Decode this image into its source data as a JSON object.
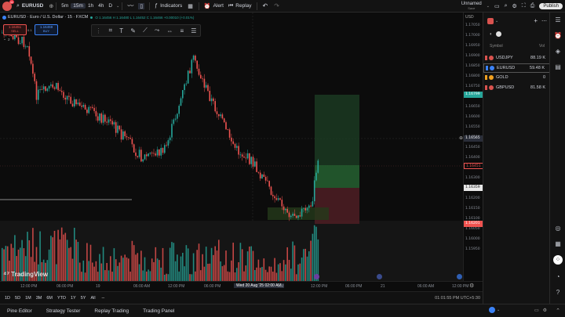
{
  "topbar": {
    "avatar_badge": "11",
    "symbol": "EURUSD",
    "intervals": [
      "5m",
      "15m",
      "1h",
      "4h",
      "D"
    ],
    "active_interval": "15m",
    "indicators_label": "Indicators",
    "alert_label": "Alert",
    "replay_label": "Replay",
    "layout_name": "Unnamed",
    "layout_status": "Save",
    "publish_label": "Publish"
  },
  "legend": {
    "title": "EURUSD · Euro / U.S. Dollar · 15 · FXCM",
    "ohlc": "O 1.16456  H 1.16480  L 1.16452  C 1.16466  +0.00010 (+0.01%)",
    "sell_price": "1.16451",
    "sell_label": "SELL",
    "spread": "0.1",
    "buy_price": "1.16459",
    "buy_label": "BUY",
    "volume_count": "2"
  },
  "price_axis": {
    "currency": "USD",
    "labels": [
      "1.17050",
      "1.17000",
      "1.16950",
      "1.16900",
      "1.16850",
      "1.16800",
      "1.16750",
      "1.16700",
      "1.16650",
      "1.16600",
      "1.16550",
      "1.16500",
      "1.16450",
      "1.16400",
      "1.16350",
      "1.16300",
      "1.16250",
      "1.16200",
      "1.16150",
      "1.16100",
      "1.16050",
      "1.16000",
      "1.15950"
    ],
    "target_price": "1.16799",
    "crosshair_price": "1.16565",
    "current_price": "1.16451",
    "entry_price": "1.16359",
    "stop_price": "1.16201"
  },
  "time_axis": {
    "labels": [
      "12:00 PM",
      "06:00 PM",
      "19",
      "06:00 AM",
      "12:00 PM",
      "06:00 PM",
      "Wed 20 Aug '25  02:00 AM",
      "AM",
      "12:00 PM",
      "06:00 PM",
      "21",
      "06:00 AM",
      "12:00 PM"
    ]
  },
  "range_bar": {
    "ranges": [
      "1D",
      "5D",
      "1M",
      "3M",
      "6M",
      "YTD",
      "1Y",
      "5Y",
      "All"
    ],
    "clock": "01:01:55 PM UTC+5:30"
  },
  "bottom_panel": {
    "tabs": [
      "Pine Editor",
      "Strategy Tester",
      "Replay Trading",
      "Trading Panel"
    ]
  },
  "watermark": "TradingView",
  "watchlist": {
    "col_symbol": "Symbol",
    "col_vol": "Vol",
    "rows": [
      {
        "symbol": "USDJPY",
        "vol": "88.19 K",
        "color": "#d9534f"
      },
      {
        "symbol": "EURUSD",
        "vol": "59.48 K",
        "color": "#3b82f6"
      },
      {
        "symbol": "GOLD",
        "vol": "0",
        "color": "#f0a020"
      },
      {
        "symbol": "GBPUSD",
        "vol": "81.58 K",
        "color": "#d9534f"
      }
    ]
  },
  "colors": {
    "up": "#26a69a",
    "down": "#ef5350",
    "target_zone": "#1f4d2a",
    "stop_zone": "#5a1f24"
  }
}
